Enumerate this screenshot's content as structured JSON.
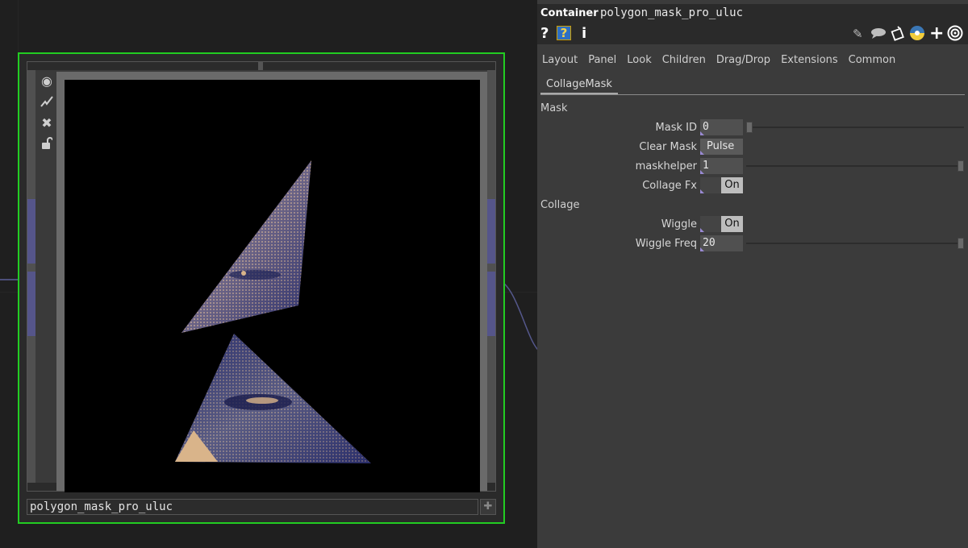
{
  "node": {
    "label": "polygon_mask_pro_uluc",
    "viewer_toolbar_icons": [
      "target-icon",
      "pulse-icon",
      "close-icon",
      "unlock-icon"
    ],
    "label_button_icon": "plus-icon"
  },
  "panel": {
    "op_type": "Container",
    "op_name": "polygon_mask_pro_uluc",
    "header_icons": [
      "help-icon",
      "op-help-icon",
      "info-icon",
      "pencil-icon",
      "comment-icon",
      "clone-icon",
      "python-icon",
      "add-icon",
      "viewer-icon"
    ],
    "help_glyph": "?",
    "info_glyph": "i",
    "add_glyph": "+",
    "tabs": [
      "Layout",
      "Panel",
      "Look",
      "Children",
      "Drag/Drop",
      "Extensions",
      "Common"
    ],
    "page_tab": "CollageMask",
    "sections": {
      "mask": "Mask",
      "collage": "Collage"
    },
    "params": {
      "mask_id": {
        "label": "Mask ID",
        "value": "0"
      },
      "clear_mask": {
        "label": "Clear Mask",
        "button": "Pulse"
      },
      "maskhelper": {
        "label": "maskhelper",
        "value": "1"
      },
      "collage_fx": {
        "label": "Collage Fx",
        "state": "On"
      },
      "wiggle": {
        "label": "Wiggle",
        "state": "On"
      },
      "wiggle_freq": {
        "label": "Wiggle Freq",
        "value": "20"
      }
    }
  },
  "colors": {
    "node_border": "#22cc22",
    "duotone_light": "#d9b48a",
    "duotone_dark": "#2a2e6a",
    "param_accent": "#9a8ad4"
  }
}
